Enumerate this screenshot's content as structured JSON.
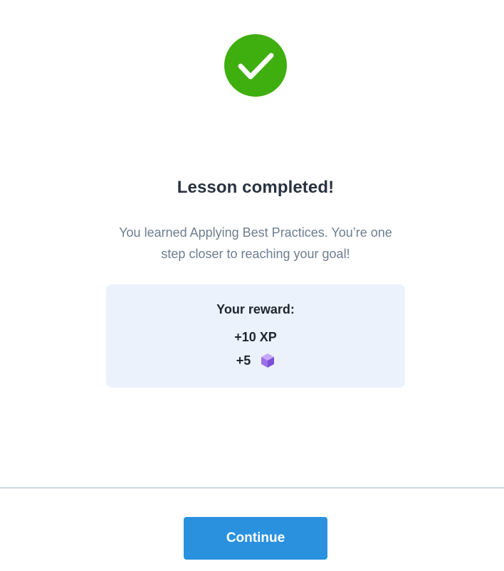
{
  "success_icon": "checkmark-icon",
  "title": "Lesson completed!",
  "subtitle": "You learned Applying Best Practices. You’re one step closer to reaching your goal!",
  "reward": {
    "heading": "Your reward:",
    "xp": "+10 XP",
    "gems": "+5",
    "gem_icon": "gem-cube-icon"
  },
  "continue_label": "Continue",
  "colors": {
    "success": "#3fae0f",
    "primary": "#2a91df",
    "reward_bg": "#ebf2fc",
    "gem": "#9b6fe8"
  }
}
